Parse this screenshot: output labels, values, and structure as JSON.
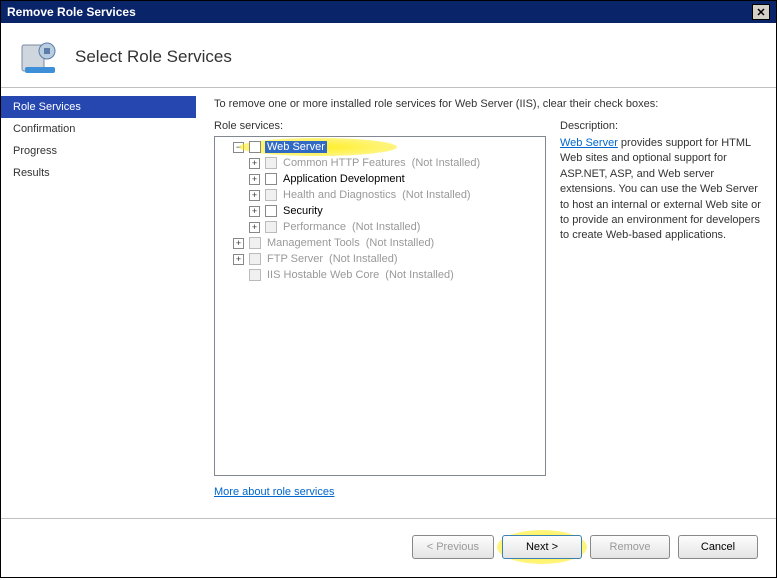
{
  "window": {
    "title": "Remove Role Services"
  },
  "page_title": "Select Role Services",
  "sidebar": {
    "items": [
      {
        "label": "Role Services",
        "active": true
      },
      {
        "label": "Confirmation",
        "active": false
      },
      {
        "label": "Progress",
        "active": false
      },
      {
        "label": "Results",
        "active": false
      }
    ]
  },
  "instruction": "To remove one or more installed role services for Web Server (IIS), clear their check boxes:",
  "tree_label": "Role services:",
  "desc_label": "Description:",
  "tree": [
    {
      "level": 0,
      "toggle": "-",
      "checked": false,
      "label": "Web Server",
      "selected": true,
      "disabled": false,
      "status": "",
      "highlighted": true
    },
    {
      "level": 1,
      "toggle": "+",
      "checked": false,
      "label": "Common HTTP Features",
      "disabled": true,
      "status": "(Not Installed)"
    },
    {
      "level": 1,
      "toggle": "+",
      "checked": false,
      "label": "Application Development",
      "disabled": false,
      "status": ""
    },
    {
      "level": 1,
      "toggle": "+",
      "checked": false,
      "label": "Health and Diagnostics",
      "disabled": true,
      "status": "(Not Installed)"
    },
    {
      "level": 1,
      "toggle": "+",
      "checked": false,
      "label": "Security",
      "disabled": false,
      "status": ""
    },
    {
      "level": 1,
      "toggle": "+",
      "checked": false,
      "label": "Performance",
      "disabled": true,
      "status": "(Not Installed)"
    },
    {
      "level": 0,
      "toggle": "+",
      "checked": false,
      "label": "Management Tools",
      "disabled": true,
      "status": "(Not Installed)"
    },
    {
      "level": 0,
      "toggle": "+",
      "checked": false,
      "label": "FTP Server",
      "disabled": true,
      "status": "(Not Installed)"
    },
    {
      "level": 0,
      "toggle": "",
      "checked": false,
      "label": "IIS Hostable Web Core",
      "disabled": true,
      "status": "(Not Installed)"
    }
  ],
  "description": {
    "link_text": "Web Server",
    "body": " provides support for HTML Web sites and optional support for ASP.NET, ASP, and Web server extensions. You can use the Web Server to host an internal or external Web site or to provide an environment for developers to create Web-based applications."
  },
  "more_link": "More about role services",
  "buttons": {
    "previous": "< Previous",
    "next": "Next >",
    "remove": "Remove",
    "cancel": "Cancel"
  }
}
